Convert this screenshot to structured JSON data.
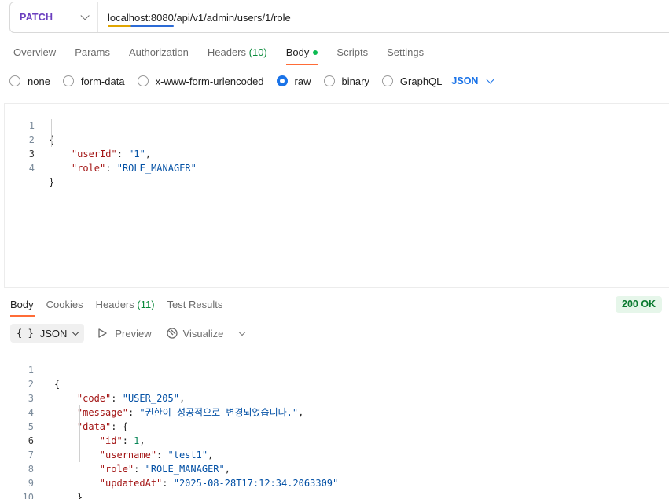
{
  "request": {
    "method": "PATCH",
    "url": "localhost:8080/api/v1/admin/users/1/role"
  },
  "request_tabs": [
    {
      "label": "Overview"
    },
    {
      "label": "Params"
    },
    {
      "label": "Authorization"
    },
    {
      "label": "Headers",
      "count": "(10)"
    },
    {
      "label": "Body"
    },
    {
      "label": "Scripts"
    },
    {
      "label": "Settings"
    }
  ],
  "body_types": [
    "none",
    "form-data",
    "x-www-form-urlencoded",
    "raw",
    "binary",
    "GraphQL"
  ],
  "selected_body_type": "raw",
  "raw_format": "JSON",
  "request_body": {
    "line_numbers": [
      "1",
      "2",
      "3",
      "4"
    ],
    "open_brace": "{",
    "close_brace": "}",
    "userId_key": "\"userId\"",
    "userId_value": "\"1\"",
    "role_key": "\"role\"",
    "role_value": "\"ROLE_MANAGER\""
  },
  "response_tabs": [
    {
      "label": "Body"
    },
    {
      "label": "Cookies"
    },
    {
      "label": "Headers",
      "count": "(11)"
    },
    {
      "label": "Test Results"
    }
  ],
  "status": "200 OK",
  "response_toolbar": {
    "braces": "{ }",
    "format": "JSON",
    "preview": "Preview",
    "visualize": "Visualize"
  },
  "response_body": {
    "line_numbers": [
      "1",
      "2",
      "3",
      "4",
      "5",
      "6",
      "7",
      "8",
      "9",
      "10"
    ],
    "open_brace": "{",
    "close_brace": "}",
    "code_key": "\"code\"",
    "code_value": "\"USER_205\"",
    "message_key": "\"message\"",
    "message_value": "\"권한이 성공적으로 변경되었습니다.\"",
    "data_key": "\"data\"",
    "id_key": "\"id\"",
    "id_value": "1",
    "username_key": "\"username\"",
    "username_value": "\"test1\"",
    "role_key": "\"role\"",
    "role_value": "\"ROLE_MANAGER\"",
    "updatedAt_key": "\"updatedAt\"",
    "updatedAt_value": "\"2025-08-28T17:12:34.2063309\""
  },
  "colors": {
    "method": "#6b3fbf",
    "active_tab_underline": "#ff6c37",
    "radio_selected": "#1a73e8",
    "status_bg": "#e6f6ea",
    "status_text": "#0a7a2f",
    "json_key": "#a31515",
    "json_string": "#0451a5",
    "json_number": "#098658"
  }
}
